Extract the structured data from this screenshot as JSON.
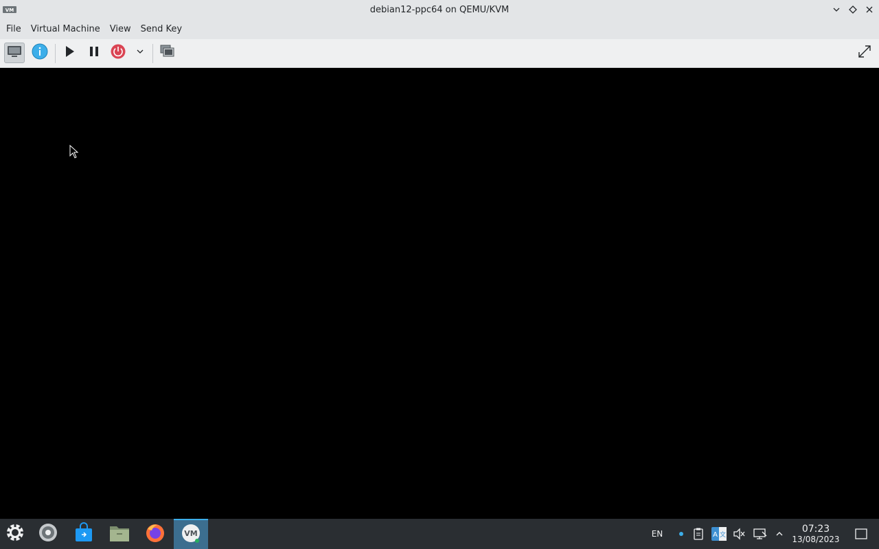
{
  "window": {
    "title": "debian12-ppc64 on QEMU/KVM",
    "app_icon": "virt-manager-icon",
    "controls": [
      "minimize-icon",
      "maximize-icon",
      "close-icon"
    ]
  },
  "menubar": {
    "items": [
      "File",
      "Virtual Machine",
      "View",
      "Send Key"
    ]
  },
  "toolbar": {
    "buttons": [
      {
        "name": "console-view-button",
        "icon": "monitor-icon",
        "active": true
      },
      {
        "name": "details-view-button",
        "icon": "info-icon",
        "active": false
      },
      {
        "name": "run-button",
        "icon": "play-icon",
        "active": false
      },
      {
        "name": "pause-button",
        "icon": "pause-icon",
        "active": false
      },
      {
        "name": "shutdown-button",
        "icon": "power-icon",
        "active": false
      },
      {
        "name": "shutdown-menu-button",
        "icon": "chevron-down-icon",
        "active": false
      },
      {
        "name": "snapshots-button",
        "icon": "snapshots-icon",
        "active": false
      },
      {
        "name": "fullscreen-button",
        "icon": "fullscreen-icon",
        "active": false
      }
    ]
  },
  "taskbar": {
    "launcher_icon": "app-launcher-icon",
    "items": [
      {
        "name": "system-settings",
        "icon": "settings-gear-icon"
      },
      {
        "name": "discover",
        "icon": "store-bag-icon"
      },
      {
        "name": "file-manager",
        "icon": "folder-icon"
      },
      {
        "name": "firefox",
        "icon": "firefox-icon"
      },
      {
        "name": "virt-manager",
        "icon": "virt-manager-icon",
        "active": true
      }
    ],
    "tray": {
      "keyboard_layout": "EN",
      "icons": [
        "notification-dot-icon",
        "clipboard-icon",
        "input-method-icon",
        "volume-muted-icon",
        "network-icon",
        "tray-expand-icon"
      ]
    },
    "clock": {
      "time": "07:23",
      "date": "13/08/2023"
    },
    "show_desktop_icon": "show-desktop-icon"
  },
  "colors": {
    "titlebar_bg": "#e3e5e7",
    "taskbar_bg": "#2a2e32",
    "accent": "#3daee9",
    "power_red": "#da4453",
    "info_blue": "#3daee9"
  }
}
